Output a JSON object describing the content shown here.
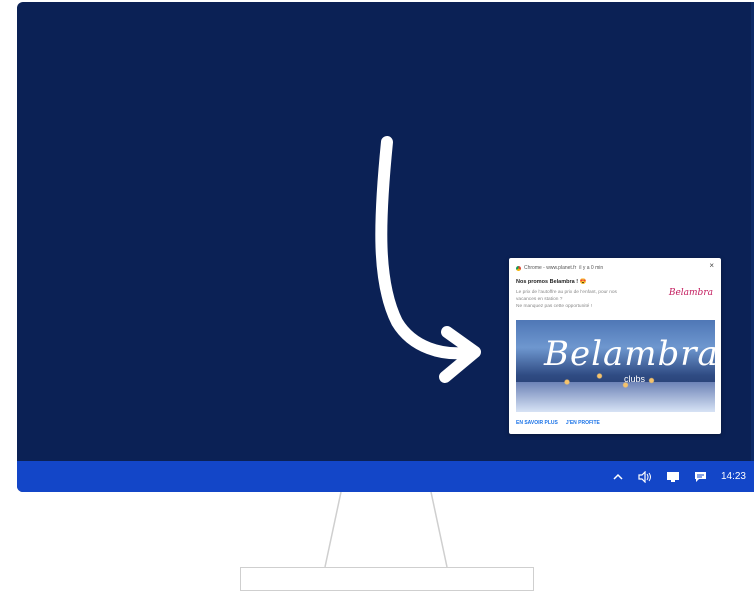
{
  "notification": {
    "source": "Chrome - www.planet.fr",
    "time": "il y a 0 min",
    "title": "Nos promos Belambra ! 😍",
    "body_line1": "Le prix de l'autoffre au prix de l'enfant, pour nos",
    "body_line2": "vacances en station ?",
    "body_line3": "Ne manquez pas cette opportunité !",
    "logo_text": "Belambra",
    "image_brand": "Belambra",
    "image_sub": "clubs",
    "close": "×",
    "actions": [
      "EN SAVOIR PLUS",
      "J'EN PROFITE"
    ]
  },
  "taskbar": {
    "clock": "14:23",
    "icons": [
      "chevron-up-icon",
      "volume-icon",
      "display-icon",
      "message-icon"
    ]
  },
  "colors": {
    "desktop": "#0b2155",
    "taskbar": "#1346c8",
    "action_link": "#1a73e8"
  }
}
